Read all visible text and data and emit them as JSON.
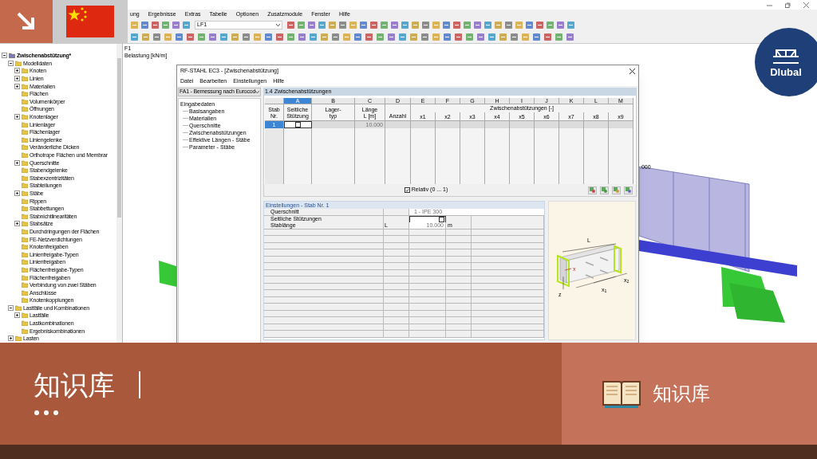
{
  "app": {
    "menu": [
      "ung",
      "Ergebnisse",
      "Extras",
      "Tabelle",
      "Optionen",
      "Zusatzmodule",
      "Fenster",
      "Hilfe"
    ],
    "load_case": "LF1",
    "tree": {
      "label": "Zwischenabstützung*",
      "kind": "expanded",
      "children": [
        {
          "label": "Modelldaten",
          "kind": "expanded",
          "children": [
            {
              "label": "Knoten",
              "kind": "collapsed"
            },
            {
              "label": "Linien",
              "kind": "collapsed"
            },
            {
              "label": "Materialien",
              "kind": "collapsed"
            },
            {
              "label": "Flächen",
              "kind": "leaf"
            },
            {
              "label": "Volumenkörper",
              "kind": "leaf"
            },
            {
              "label": "Öffnungen",
              "kind": "leaf"
            },
            {
              "label": "Knotenlager",
              "kind": "collapsed"
            },
            {
              "label": "Linienlager",
              "kind": "leaf"
            },
            {
              "label": "Flächenlager",
              "kind": "leaf"
            },
            {
              "label": "Liniengelenke",
              "kind": "leaf"
            },
            {
              "label": "Veränderliche Dicken",
              "kind": "leaf"
            },
            {
              "label": "Orthotrope Flächen und Membrar",
              "kind": "leaf"
            },
            {
              "label": "Querschnitte",
              "kind": "collapsed"
            },
            {
              "label": "Stabendgelenke",
              "kind": "leaf"
            },
            {
              "label": "Stabexzentrizitäten",
              "kind": "leaf"
            },
            {
              "label": "Stabteilungen",
              "kind": "leaf"
            },
            {
              "label": "Stäbe",
              "kind": "collapsed"
            },
            {
              "label": "Rippen",
              "kind": "leaf"
            },
            {
              "label": "Stabbettungen",
              "kind": "leaf"
            },
            {
              "label": "Stabnichtlinearitäten",
              "kind": "leaf"
            },
            {
              "label": "Stabsätze",
              "kind": "collapsed"
            },
            {
              "label": "Durchdringungen der Flächen",
              "kind": "leaf"
            },
            {
              "label": "FE-Netzverdichtungen",
              "kind": "leaf"
            },
            {
              "label": "Knotenfreigaben",
              "kind": "leaf"
            },
            {
              "label": "Linienfreigabe-Typen",
              "kind": "leaf"
            },
            {
              "label": "Linienfreigaben",
              "kind": "leaf"
            },
            {
              "label": "Flächenfreigabe-Typen",
              "kind": "leaf"
            },
            {
              "label": "Flächenfreigaben",
              "kind": "leaf"
            },
            {
              "label": "Verbindung von zwei Stäben",
              "kind": "leaf"
            },
            {
              "label": "Anschlüsse",
              "kind": "leaf"
            },
            {
              "label": "Knotenkopplungen",
              "kind": "leaf"
            }
          ]
        },
        {
          "label": "Lastfälle und Kombinationen",
          "kind": "expanded",
          "children": [
            {
              "label": "Lastfälle",
              "kind": "collapsed"
            },
            {
              "label": "Lastkombinationen",
              "kind": "leaf"
            },
            {
              "label": "Ergebniskombinationen",
              "kind": "leaf"
            }
          ]
        },
        {
          "label": "Lasten",
          "kind": "collapsed"
        }
      ]
    },
    "canvas": {
      "case_label": "F1",
      "load_label": "Belastung [kN/m]",
      "load_value": ".000"
    },
    "brand": "Dlubal"
  },
  "dialog": {
    "title": "RF-STAHL EC3 - [Zwischenabstützung]",
    "menu": [
      "Datei",
      "Bearbeiten",
      "Einstellungen",
      "Hilfe"
    ],
    "case": "FA1 - Bemessung nach Eurocod",
    "nav": {
      "label": "Eingabedaten",
      "children": [
        {
          "label": "Basisangaben",
          "selected": false
        },
        {
          "label": "Materialien",
          "selected": false
        },
        {
          "label": "Querschnitte",
          "selected": false
        },
        {
          "label": "Zwischenabstützungen",
          "selected": false
        },
        {
          "label": "Effektive Längen - Stäbe",
          "selected": false
        },
        {
          "label": "Parameter - Stäbe",
          "selected": false
        }
      ]
    },
    "section": "1.4 Zwischenabstützungen",
    "table": {
      "columns": [
        {
          "header": "Stab\nNr.",
          "selected": false
        },
        {
          "letter": "A",
          "header": "Seitliche\nStützung",
          "selected": true
        },
        {
          "letter": "B",
          "header": "Lager-\ntyp",
          "selected": false
        },
        {
          "letter": "C",
          "header": "Länge\nL [m]",
          "selected": false
        },
        {
          "letter": "D",
          "header": "Anzahl",
          "selected": false
        }
      ],
      "group": {
        "header": "Zwischenabstützungen [-]",
        "columns": [
          {
            "letter": "E",
            "header": "x1",
            "selected": false
          },
          {
            "letter": "F",
            "header": "x2",
            "selected": false
          },
          {
            "letter": "G",
            "header": "x3",
            "selected": false
          },
          {
            "letter": "H",
            "header": "x4",
            "selected": false
          },
          {
            "letter": "I",
            "header": "x5",
            "selected": false
          },
          {
            "letter": "J",
            "header": "x6",
            "selected": false
          },
          {
            "letter": "K",
            "header": "x7",
            "selected": false
          },
          {
            "letter": "L",
            "header": "x8",
            "selected": false
          },
          {
            "letter": "M",
            "header": "x9",
            "selected": false
          }
        ]
      },
      "rows": [
        {
          "member": "1",
          "selected": true,
          "lateral_support": {
            "checked": false
          },
          "length": "10.000"
        }
      ]
    },
    "relative": {
      "label": "Relativ (0 ... 1)",
      "checked": true
    },
    "settings": {
      "title": "Einstellungen - Stab Nr. 1",
      "rows": [
        {
          "kind": "text",
          "label": "Querschnitt",
          "value": "1 - IPE 300"
        },
        {
          "kind": "checkbox",
          "label": "Seitliche Stützungen",
          "checked": false
        },
        {
          "kind": "text",
          "label": "Stablänge",
          "symbol": "L",
          "value": "10.000",
          "unit": "m"
        }
      ]
    },
    "diagram": {
      "length": "L",
      "x_axis": "x",
      "z_axis": "z",
      "x1": "x$_{1}$",
      "x2": "x$_{2}$"
    }
  },
  "banner": {
    "title": "知识库",
    "label": "知识库"
  }
}
